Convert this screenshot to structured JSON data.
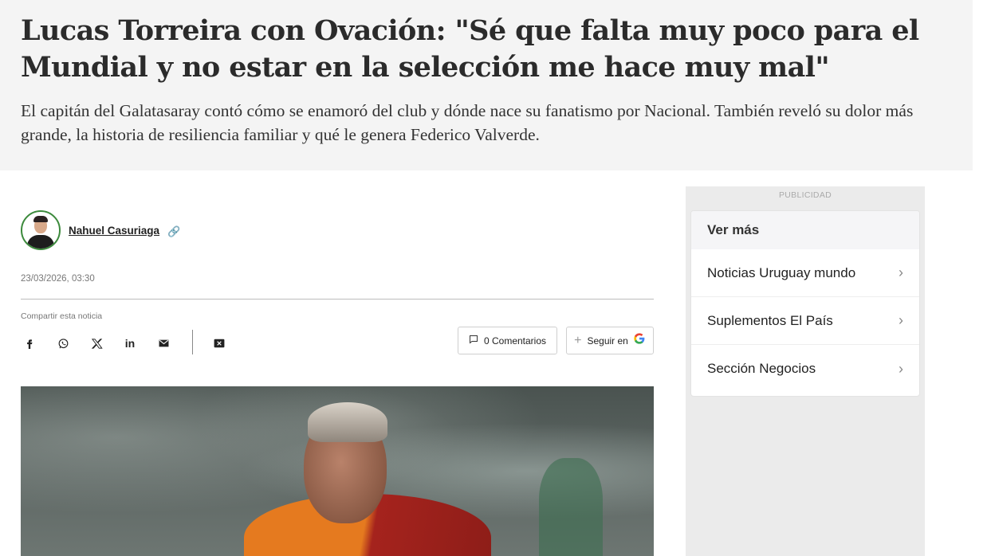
{
  "article": {
    "headline": "Lucas Torreira con Ovación: \"Sé que falta muy poco para el Mundial y no estar en la selección me hace muy mal\"",
    "subheadline": "El capitán del Galatasaray contó cómo se enamoró del club y dónde nace su fanatismo por Nacional. También reveló su dolor más grande, la historia de resiliencia familiar y qué le genera Federico Valverde.",
    "author": "Nahuel Casuriaga",
    "date": "23/03/2026, 03:30"
  },
  "share": {
    "label": "Compartir esta noticia",
    "icons": [
      "facebook-icon",
      "whatsapp-icon",
      "x-icon",
      "linkedin-icon",
      "email-icon",
      "reader-icon"
    ],
    "comments_label": "0 Comentarios",
    "follow_label": "Seguir en"
  },
  "sidebar": {
    "ad_label": "PUBLICIDAD",
    "title": "Ver más",
    "items": [
      {
        "label": "Noticias Uruguay mundo"
      },
      {
        "label": "Suplementos El País"
      },
      {
        "label": "Sección Negocios"
      }
    ]
  },
  "colors": {
    "hero_bg": "#f4f4f4",
    "avatar_border": "#3c8a3c",
    "sidebar_bg": "#ebebeb"
  }
}
